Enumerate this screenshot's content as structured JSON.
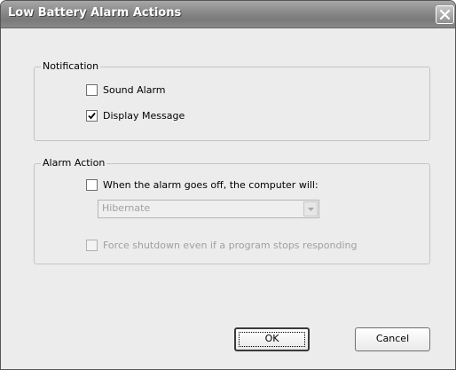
{
  "window": {
    "title": "Low Battery Alarm Actions"
  },
  "notification": {
    "title": "Notification",
    "sound_alarm": {
      "label": "Sound Alarm",
      "checked": false
    },
    "display_message": {
      "label": "Display Message",
      "checked": true
    }
  },
  "alarm_action": {
    "title": "Alarm Action",
    "when_alarm": {
      "label": "When the alarm goes off, the computer will:",
      "checked": false
    },
    "action_select": {
      "value": "Hibernate",
      "enabled": false
    },
    "force_shutdown": {
      "label": "Force shutdown even if a program stops responding",
      "checked": false,
      "enabled": false
    }
  },
  "buttons": {
    "ok": "OK",
    "cancel": "Cancel"
  }
}
